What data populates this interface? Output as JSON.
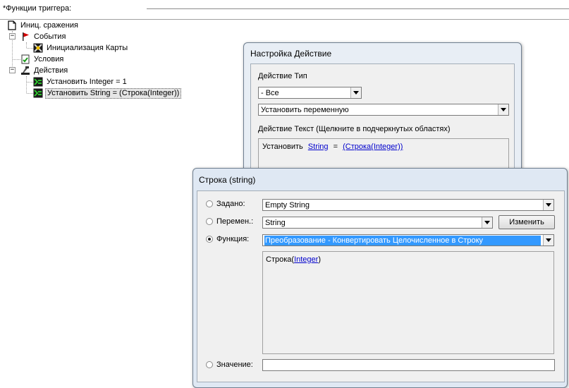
{
  "panel": {
    "title": "*Функции триггера:"
  },
  "tree": {
    "root": {
      "label": "Иниц. сражения",
      "icon": "document-icon"
    },
    "events": {
      "label": "События",
      "icon": "red-flag-icon"
    },
    "event_item": {
      "label": "Инициализация Карты",
      "icon": "map-event-icon"
    },
    "conditions": {
      "label": "Условия",
      "icon": "conditions-icon"
    },
    "actions": {
      "label": "Действия",
      "icon": "actions-icon"
    },
    "action_items": [
      {
        "label": "Установить Integer = 1",
        "icon": "set-variable-icon"
      },
      {
        "label": "Установить String = (Строка(Integer))",
        "icon": "set-variable-icon"
      }
    ]
  },
  "action_dialog": {
    "title": "Настройка Действие",
    "type_label": "Действие Тип",
    "type_value": "- Все",
    "action_value": "Установить переменную",
    "text_label": "Действие Текст (Щелкните в подчеркнутых областях)",
    "text_prefix": "Установить",
    "text_var": "String",
    "text_eq": "=",
    "text_func": "(Строка(Integer))"
  },
  "string_dialog": {
    "title": "Строка (string)",
    "preset_label": "Задано:",
    "preset_value": "Empty String",
    "variable_label": "Перемен.:",
    "variable_value": "String",
    "edit_button": "Изменить",
    "function_label": "Функция:",
    "function_value": "Преобразование - Конвертировать Целочисленное в Строку",
    "function_text_prefix": "Строка(",
    "function_text_link": "Integer",
    "function_text_suffix": ")",
    "value_label": "Значение:",
    "value_input": "",
    "selected_option": "function"
  },
  "colors": {
    "selection": "#3399ff",
    "link": "#0000cc",
    "dialog_frame": "#e8eef5"
  }
}
